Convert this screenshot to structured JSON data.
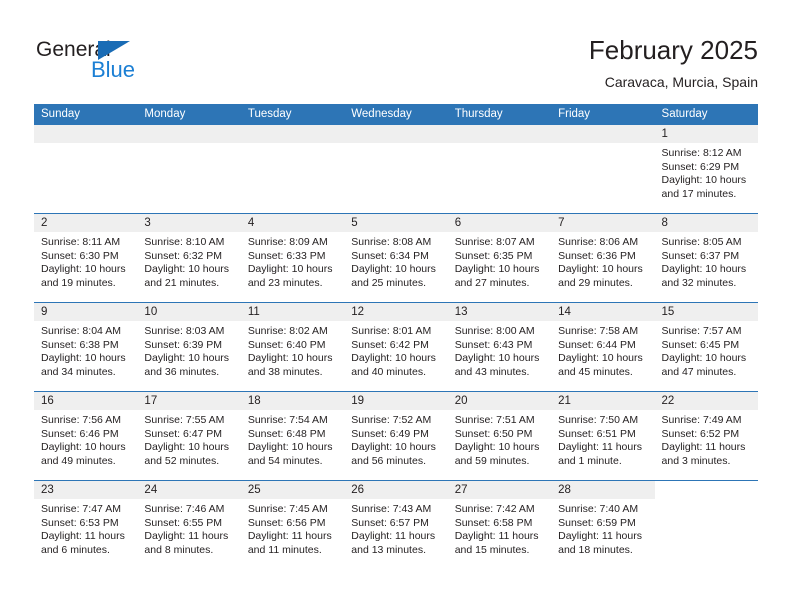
{
  "brand": {
    "name_part1": "General",
    "name_part2": "Blue",
    "accent_color": "#1b7fd4",
    "triangle_color": "#1a6cb5"
  },
  "header": {
    "title": "February 2025",
    "subtitle": "Caravaca, Murcia, Spain"
  },
  "calendar": {
    "header_bg": "#2d75b6",
    "daynum_bg": "#efefef",
    "weekdays": [
      "Sunday",
      "Monday",
      "Tuesday",
      "Wednesday",
      "Thursday",
      "Friday",
      "Saturday"
    ],
    "weeks": [
      [
        {
          "day": "",
          "empty": true,
          "lines": []
        },
        {
          "day": "",
          "empty": true,
          "lines": []
        },
        {
          "day": "",
          "empty": true,
          "lines": []
        },
        {
          "day": "",
          "empty": true,
          "lines": []
        },
        {
          "day": "",
          "empty": true,
          "lines": []
        },
        {
          "day": "",
          "empty": true,
          "lines": []
        },
        {
          "day": "1",
          "empty": false,
          "lines": [
            "Sunrise: 8:12 AM",
            "Sunset: 6:29 PM",
            "Daylight: 10 hours and 17 minutes."
          ]
        }
      ],
      [
        {
          "day": "2",
          "empty": false,
          "lines": [
            "Sunrise: 8:11 AM",
            "Sunset: 6:30 PM",
            "Daylight: 10 hours and 19 minutes."
          ]
        },
        {
          "day": "3",
          "empty": false,
          "lines": [
            "Sunrise: 8:10 AM",
            "Sunset: 6:32 PM",
            "Daylight: 10 hours and 21 minutes."
          ]
        },
        {
          "day": "4",
          "empty": false,
          "lines": [
            "Sunrise: 8:09 AM",
            "Sunset: 6:33 PM",
            "Daylight: 10 hours and 23 minutes."
          ]
        },
        {
          "day": "5",
          "empty": false,
          "lines": [
            "Sunrise: 8:08 AM",
            "Sunset: 6:34 PM",
            "Daylight: 10 hours and 25 minutes."
          ]
        },
        {
          "day": "6",
          "empty": false,
          "lines": [
            "Sunrise: 8:07 AM",
            "Sunset: 6:35 PM",
            "Daylight: 10 hours and 27 minutes."
          ]
        },
        {
          "day": "7",
          "empty": false,
          "lines": [
            "Sunrise: 8:06 AM",
            "Sunset: 6:36 PM",
            "Daylight: 10 hours and 29 minutes."
          ]
        },
        {
          "day": "8",
          "empty": false,
          "lines": [
            "Sunrise: 8:05 AM",
            "Sunset: 6:37 PM",
            "Daylight: 10 hours and 32 minutes."
          ]
        }
      ],
      [
        {
          "day": "9",
          "empty": false,
          "lines": [
            "Sunrise: 8:04 AM",
            "Sunset: 6:38 PM",
            "Daylight: 10 hours and 34 minutes."
          ]
        },
        {
          "day": "10",
          "empty": false,
          "lines": [
            "Sunrise: 8:03 AM",
            "Sunset: 6:39 PM",
            "Daylight: 10 hours and 36 minutes."
          ]
        },
        {
          "day": "11",
          "empty": false,
          "lines": [
            "Sunrise: 8:02 AM",
            "Sunset: 6:40 PM",
            "Daylight: 10 hours and 38 minutes."
          ]
        },
        {
          "day": "12",
          "empty": false,
          "lines": [
            "Sunrise: 8:01 AM",
            "Sunset: 6:42 PM",
            "Daylight: 10 hours and 40 minutes."
          ]
        },
        {
          "day": "13",
          "empty": false,
          "lines": [
            "Sunrise: 8:00 AM",
            "Sunset: 6:43 PM",
            "Daylight: 10 hours and 43 minutes."
          ]
        },
        {
          "day": "14",
          "empty": false,
          "lines": [
            "Sunrise: 7:58 AM",
            "Sunset: 6:44 PM",
            "Daylight: 10 hours and 45 minutes."
          ]
        },
        {
          "day": "15",
          "empty": false,
          "lines": [
            "Sunrise: 7:57 AM",
            "Sunset: 6:45 PM",
            "Daylight: 10 hours and 47 minutes."
          ]
        }
      ],
      [
        {
          "day": "16",
          "empty": false,
          "lines": [
            "Sunrise: 7:56 AM",
            "Sunset: 6:46 PM",
            "Daylight: 10 hours and 49 minutes."
          ]
        },
        {
          "day": "17",
          "empty": false,
          "lines": [
            "Sunrise: 7:55 AM",
            "Sunset: 6:47 PM",
            "Daylight: 10 hours and 52 minutes."
          ]
        },
        {
          "day": "18",
          "empty": false,
          "lines": [
            "Sunrise: 7:54 AM",
            "Sunset: 6:48 PM",
            "Daylight: 10 hours and 54 minutes."
          ]
        },
        {
          "day": "19",
          "empty": false,
          "lines": [
            "Sunrise: 7:52 AM",
            "Sunset: 6:49 PM",
            "Daylight: 10 hours and 56 minutes."
          ]
        },
        {
          "day": "20",
          "empty": false,
          "lines": [
            "Sunrise: 7:51 AM",
            "Sunset: 6:50 PM",
            "Daylight: 10 hours and 59 minutes."
          ]
        },
        {
          "day": "21",
          "empty": false,
          "lines": [
            "Sunrise: 7:50 AM",
            "Sunset: 6:51 PM",
            "Daylight: 11 hours and 1 minute."
          ]
        },
        {
          "day": "22",
          "empty": false,
          "lines": [
            "Sunrise: 7:49 AM",
            "Sunset: 6:52 PM",
            "Daylight: 11 hours and 3 minutes."
          ]
        }
      ],
      [
        {
          "day": "23",
          "empty": false,
          "lines": [
            "Sunrise: 7:47 AM",
            "Sunset: 6:53 PM",
            "Daylight: 11 hours and 6 minutes."
          ]
        },
        {
          "day": "24",
          "empty": false,
          "lines": [
            "Sunrise: 7:46 AM",
            "Sunset: 6:55 PM",
            "Daylight: 11 hours and 8 minutes."
          ]
        },
        {
          "day": "25",
          "empty": false,
          "lines": [
            "Sunrise: 7:45 AM",
            "Sunset: 6:56 PM",
            "Daylight: 11 hours and 11 minutes."
          ]
        },
        {
          "day": "26",
          "empty": false,
          "lines": [
            "Sunrise: 7:43 AM",
            "Sunset: 6:57 PM",
            "Daylight: 11 hours and 13 minutes."
          ]
        },
        {
          "day": "27",
          "empty": false,
          "lines": [
            "Sunrise: 7:42 AM",
            "Sunset: 6:58 PM",
            "Daylight: 11 hours and 15 minutes."
          ]
        },
        {
          "day": "28",
          "empty": false,
          "lines": [
            "Sunrise: 7:40 AM",
            "Sunset: 6:59 PM",
            "Daylight: 11 hours and 18 minutes."
          ]
        },
        {
          "day": "",
          "empty": true,
          "blank": true,
          "lines": []
        }
      ]
    ]
  }
}
